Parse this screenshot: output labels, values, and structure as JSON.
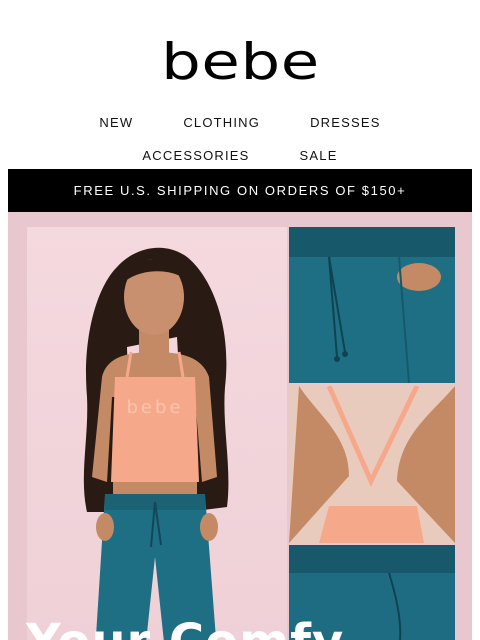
{
  "brand": {
    "logo_text": "bebe"
  },
  "nav": {
    "row1": [
      "NEW",
      "CLOTHING",
      "DRESSES"
    ],
    "row2": [
      "ACCESSORIES",
      "SALE"
    ]
  },
  "promo": {
    "text": "FREE U.S. SHIPPING ON ORDERS OF $150+"
  },
  "hero": {
    "headline": "Your Comfy",
    "top_print": "bebe",
    "colors": {
      "background": "#e9c7cf",
      "pants": "#1f6f84",
      "top": "#f6a98a",
      "skin": "#c48a66",
      "hair": "#2a1a14"
    }
  }
}
